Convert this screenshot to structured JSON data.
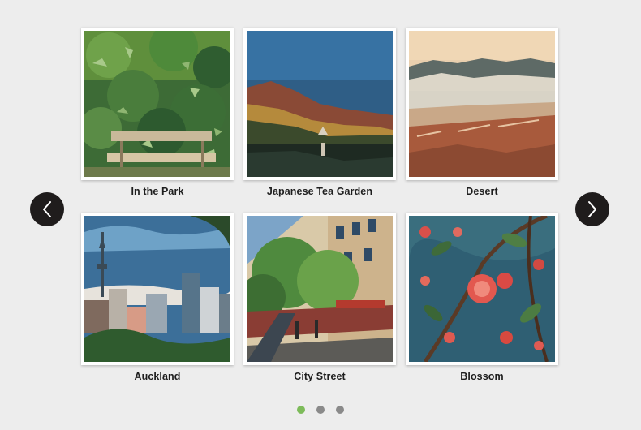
{
  "gallery": {
    "items": [
      {
        "caption": "In the Park",
        "image": "park-bench-painting"
      },
      {
        "caption": "Japanese Tea Garden",
        "image": "hills-garden-painting"
      },
      {
        "caption": "Desert",
        "image": "desert-lake-painting"
      },
      {
        "caption": "Auckland",
        "image": "city-skyline-tower-painting"
      },
      {
        "caption": "City Street",
        "image": "street-trees-painting"
      },
      {
        "caption": "Blossom",
        "image": "camellia-flowers-painting"
      }
    ]
  },
  "navigation": {
    "prev_icon": "chevron-left-icon",
    "next_icon": "chevron-right-icon"
  },
  "pagination": {
    "pages": 3,
    "active": 1,
    "colors": {
      "active": "#7dbb5a",
      "inactive": "#8a8a8a"
    }
  }
}
